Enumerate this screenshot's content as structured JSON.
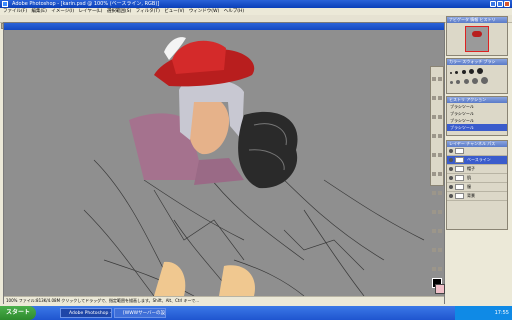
{
  "window": {
    "title": "Adobe Photoshop - [karin.psd @ 100% (ベースライン, RGB)]"
  },
  "menu": [
    "ファイル(F)",
    "編集(E)",
    "イメージ(I)",
    "レイヤー(L)",
    "選択範囲(S)",
    "フィルタ(T)",
    "ビュー(V)",
    "ウィンドウ(W)",
    "ヘルプ(H)"
  ],
  "document": {
    "status": "100%  ファイル:813K/4.08M  クリックしてドラッグで、指定範囲を描画します。Shift、Alt、Ctrl キーで..."
  },
  "navigator": {
    "title": "ナビゲータ  情報  ヒストリ"
  },
  "brushes": {
    "title": "カラー  スウォッチ  ブラシ"
  },
  "history": {
    "title": "ヒストリ  アクション",
    "items": [
      "ブラシツール",
      "ブラシツール",
      "ブラシツール",
      "ブラシツール"
    ]
  },
  "layers": {
    "title": "レイヤー  チャンネル  パス",
    "items": [
      "",
      "ベースライン",
      "帽子",
      "肌",
      "服",
      "背景"
    ],
    "selected_index": 1
  },
  "taskbar": {
    "start": "スタート",
    "tasks": [
      "Adobe Photoshop - [..",
      "[WWWサーバーの設定]..."
    ],
    "clock": "17:55"
  },
  "colors": {
    "title_blue": "#1448c0",
    "canvas_gray": "#8f8f8f",
    "hat_red": "#b81e1e",
    "skin": "#f0c890"
  }
}
